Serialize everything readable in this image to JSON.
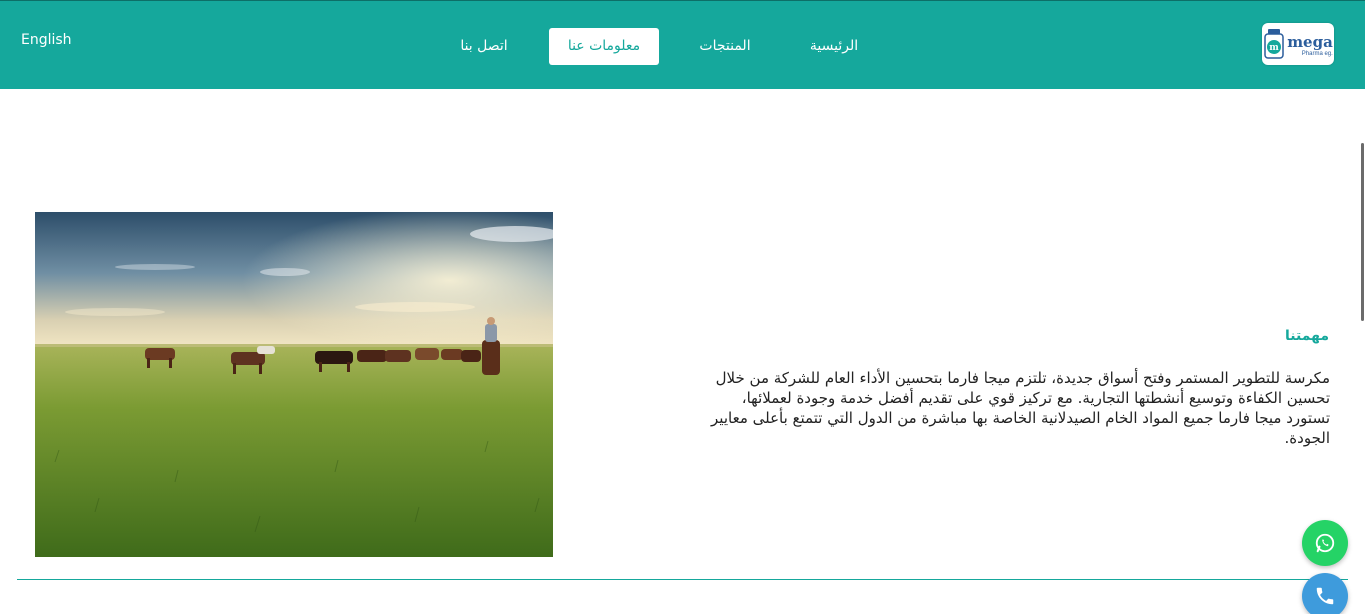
{
  "header": {
    "language_link": "English",
    "nav": {
      "home": "الرئيسية",
      "products": "المنتجات",
      "about": "معلومات عنا",
      "contact": "اتصل بنا"
    },
    "logo": {
      "text": "mega",
      "sub": "Pharma eg."
    }
  },
  "main": {
    "image_icon": "cattle-field-photo",
    "section_title": "مهمتنا",
    "section_body": "مكرسة للتطوير المستمر وفتح أسواق جديدة، تلتزم ميجا فارما بتحسين الأداء العام للشركة من خلال تحسين الكفاءة وتوسيع أنشطتها التجارية. مع تركيز قوي على تقديم أفضل خدمة وجودة لعملائها، تستورد ميجا فارما جميع المواد الخام الصيدلانية الخاصة بها مباشرة من الدول التي تتمتع بأعلى معايير الجودة."
  },
  "floating": {
    "whatsapp_icon": "whatsapp-icon",
    "phone_icon": "phone-icon"
  },
  "colors": {
    "brand": "#15a89c",
    "whatsapp": "#25d366",
    "phone": "#3e9bdc"
  }
}
